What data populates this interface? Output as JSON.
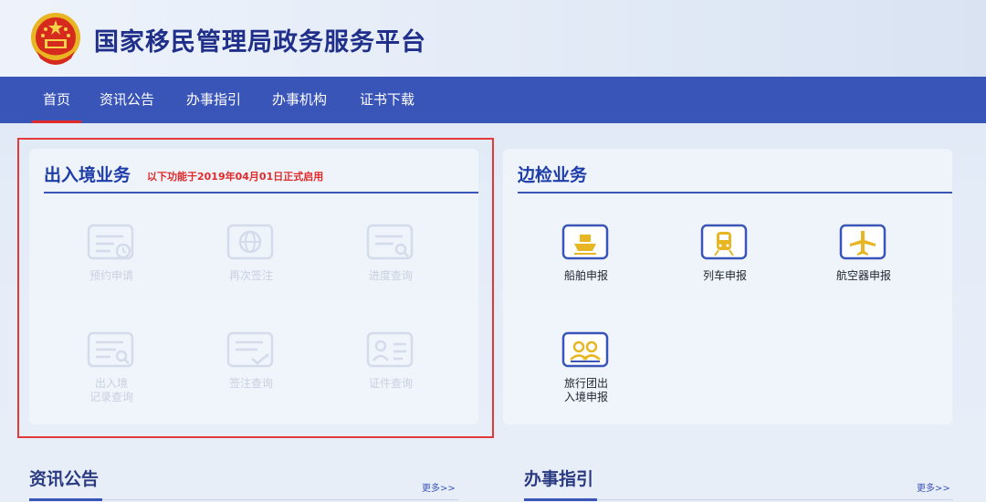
{
  "header": {
    "title": "国家移民管理局政务服务平台",
    "emblem_icon": "national-emblem-icon"
  },
  "nav": {
    "items": [
      {
        "label": "首页",
        "active": true
      },
      {
        "label": "资讯公告",
        "active": false
      },
      {
        "label": "办事指引",
        "active": false
      },
      {
        "label": "办事机构",
        "active": false
      },
      {
        "label": "证书下载",
        "active": false
      }
    ]
  },
  "entry_exit": {
    "title": "出入境业务",
    "note": "以下功能于2019年04月01日正式启用",
    "services": [
      {
        "label": "预约申请",
        "icon": "form-clock-icon"
      },
      {
        "label": "再次签注",
        "icon": "globe-card-icon"
      },
      {
        "label": "进度查询",
        "icon": "document-search-icon"
      },
      {
        "label": "出入境",
        "label2": "记录查询",
        "icon": "record-search-icon"
      },
      {
        "label": "签注查询",
        "icon": "document-check-icon"
      },
      {
        "label": "证件查询",
        "icon": "id-card-icon"
      }
    ]
  },
  "border_check": {
    "title": "边检业务",
    "services": [
      {
        "label": "船舶申报",
        "icon": "ship-icon"
      },
      {
        "label": "列车申报",
        "icon": "train-icon"
      },
      {
        "label": "航空器申报",
        "icon": "airplane-icon"
      },
      {
        "label": "旅行团出",
        "label2": "入境申报",
        "icon": "tour-group-icon"
      }
    ]
  },
  "sections": {
    "news": {
      "title": "资讯公告",
      "more": "更多>>"
    },
    "guide": {
      "title": "办事指引",
      "more": "更多>>"
    }
  },
  "colors": {
    "primary": "#3a55b8",
    "title_blue": "#1f3da8",
    "accent_red": "#e02a2a",
    "icon_gold": "#e8b623",
    "disabled_icon": "#d4dceb"
  }
}
